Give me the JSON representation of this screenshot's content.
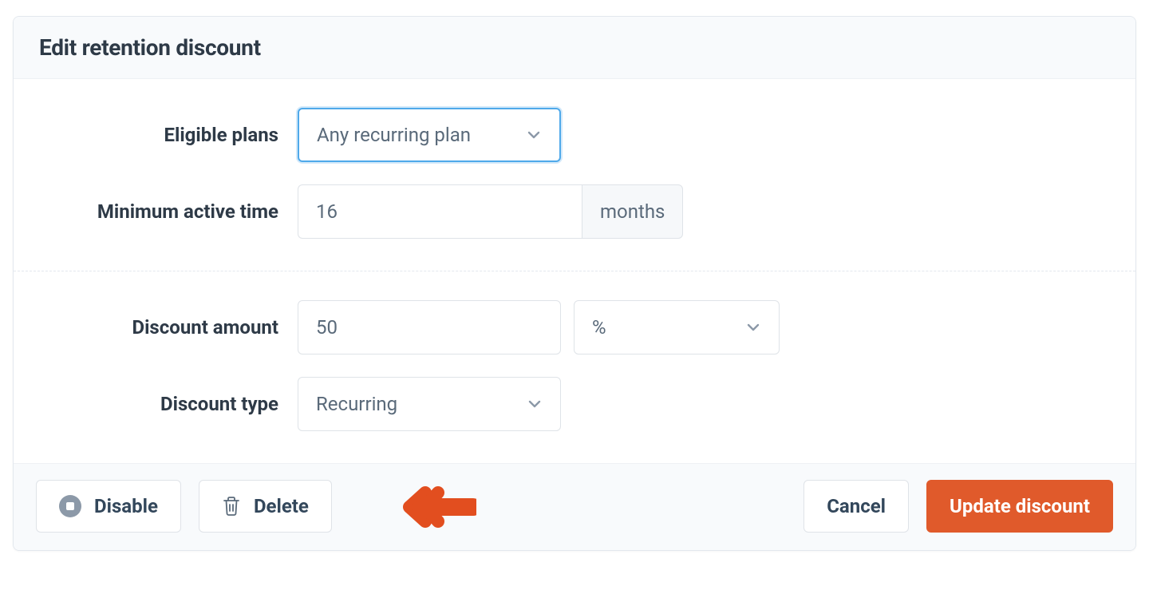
{
  "header": {
    "title": "Edit retention discount"
  },
  "form": {
    "eligible_plans": {
      "label": "Eligible plans",
      "value": "Any recurring plan"
    },
    "min_active_time": {
      "label": "Minimum active time",
      "value": "16",
      "unit": "months"
    },
    "discount_amount": {
      "label": "Discount amount",
      "value": "50",
      "unit": "%"
    },
    "discount_type": {
      "label": "Discount type",
      "value": "Recurring"
    }
  },
  "footer": {
    "disable_label": "Disable",
    "delete_label": "Delete",
    "cancel_label": "Cancel",
    "update_label": "Update discount"
  },
  "colors": {
    "accent": "#e05a2b",
    "focus": "#4fa9ea",
    "annotation": "#e24e1f"
  }
}
